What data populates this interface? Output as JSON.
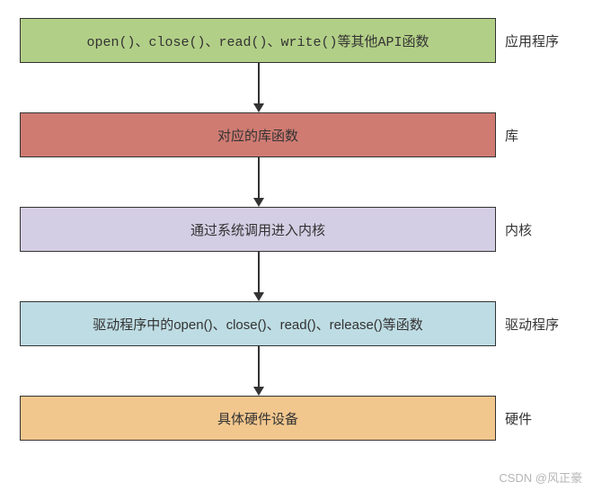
{
  "layers": [
    {
      "text": "open()、close()、read()、write()等其他API函数",
      "label": "应用程序",
      "color": "#b2cf87",
      "mono": true
    },
    {
      "text": "对应的库函数",
      "label": "库",
      "color": "#cf7b72",
      "mono": false
    },
    {
      "text": "通过系统调用进入内核",
      "label": "内核",
      "color": "#d4cee4",
      "mono": false
    },
    {
      "text": "驱动程序中的open()、close()、read()、release()等函数",
      "label": "驱动程序",
      "color": "#bedce3",
      "mono": false
    },
    {
      "text": "具体硬件设备",
      "label": "硬件",
      "color": "#f2c78e",
      "mono": false
    }
  ],
  "watermark": "CSDN @风正豪"
}
